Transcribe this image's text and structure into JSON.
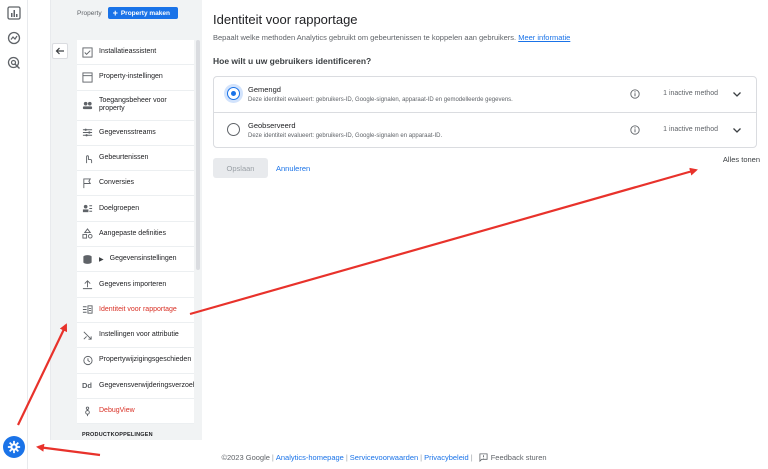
{
  "rail": {
    "icons": [
      "reports-icon",
      "explore-icon",
      "advertising-icon",
      "admin-gear-icon"
    ]
  },
  "panel": {
    "property_label": "Property",
    "create_button": "Property maken",
    "items": [
      {
        "label": "Installatieassistent",
        "icon": "checklist-icon"
      },
      {
        "label": "Property-instellingen",
        "icon": "property-settings-icon"
      },
      {
        "label": "Toegangsbeheer voor property",
        "icon": "people-icon"
      },
      {
        "label": "Gegevensstreams",
        "icon": "streams-icon"
      },
      {
        "label": "Gebeurtenissen",
        "icon": "touch-icon"
      },
      {
        "label": "Conversies",
        "icon": "flag-icon"
      },
      {
        "label": "Doelgroepen",
        "icon": "audience-icon"
      },
      {
        "label": "Aangepaste definities",
        "icon": "shapes-icon"
      },
      {
        "label": "Gegevensinstellingen",
        "icon": "database-icon"
      },
      {
        "label": "Gegevens importeren",
        "icon": "upload-icon"
      },
      {
        "label": "Identiteit voor rapportage",
        "icon": "identity-icon"
      },
      {
        "label": "Instellingen voor attributie",
        "icon": "attribution-icon"
      },
      {
        "label": "Propertywijzigingsgeschieden",
        "icon": "history-icon"
      },
      {
        "label": "Gegevensverwijderingsverzoel",
        "icon": "dd-icon"
      },
      {
        "label": "DebugView",
        "icon": "debug-icon"
      }
    ],
    "section_caption": "PRODUCTKOPPELINGEN"
  },
  "main": {
    "title": "Identiteit voor rapportage",
    "description": "Bepaalt welke methoden Analytics gebruikt om gebeurtenissen te koppelen aan gebruikers.",
    "more_info": "Meer informatie",
    "question": "Hoe wilt u uw gebruikers identificeren?",
    "options": [
      {
        "title": "Gemengd",
        "description": "Deze identiteit evalueert: gebruikers-ID, Google-signalen, apparaat-ID en gemodelleerde gegevens.",
        "meta": "1 inactive method",
        "selected": true
      },
      {
        "title": "Geobserveerd",
        "description": "Deze identiteit evalueert: gebruikers-ID, Google-signalen en apparaat-ID.",
        "meta": "1 inactive method",
        "selected": false
      }
    ],
    "save_button": "Opslaan",
    "cancel_button": "Annuleren",
    "show_all": "Alles tonen"
  },
  "footer": {
    "copyright": "©2023 Google",
    "links": [
      "Analytics-homepage",
      "Servicevoorwaarden",
      "Privacybeleid"
    ],
    "feedback": "Feedback sturen"
  },
  "colors": {
    "accent": "#1a73e8",
    "active_item": "#d93025",
    "arrow": "#e8322b"
  }
}
